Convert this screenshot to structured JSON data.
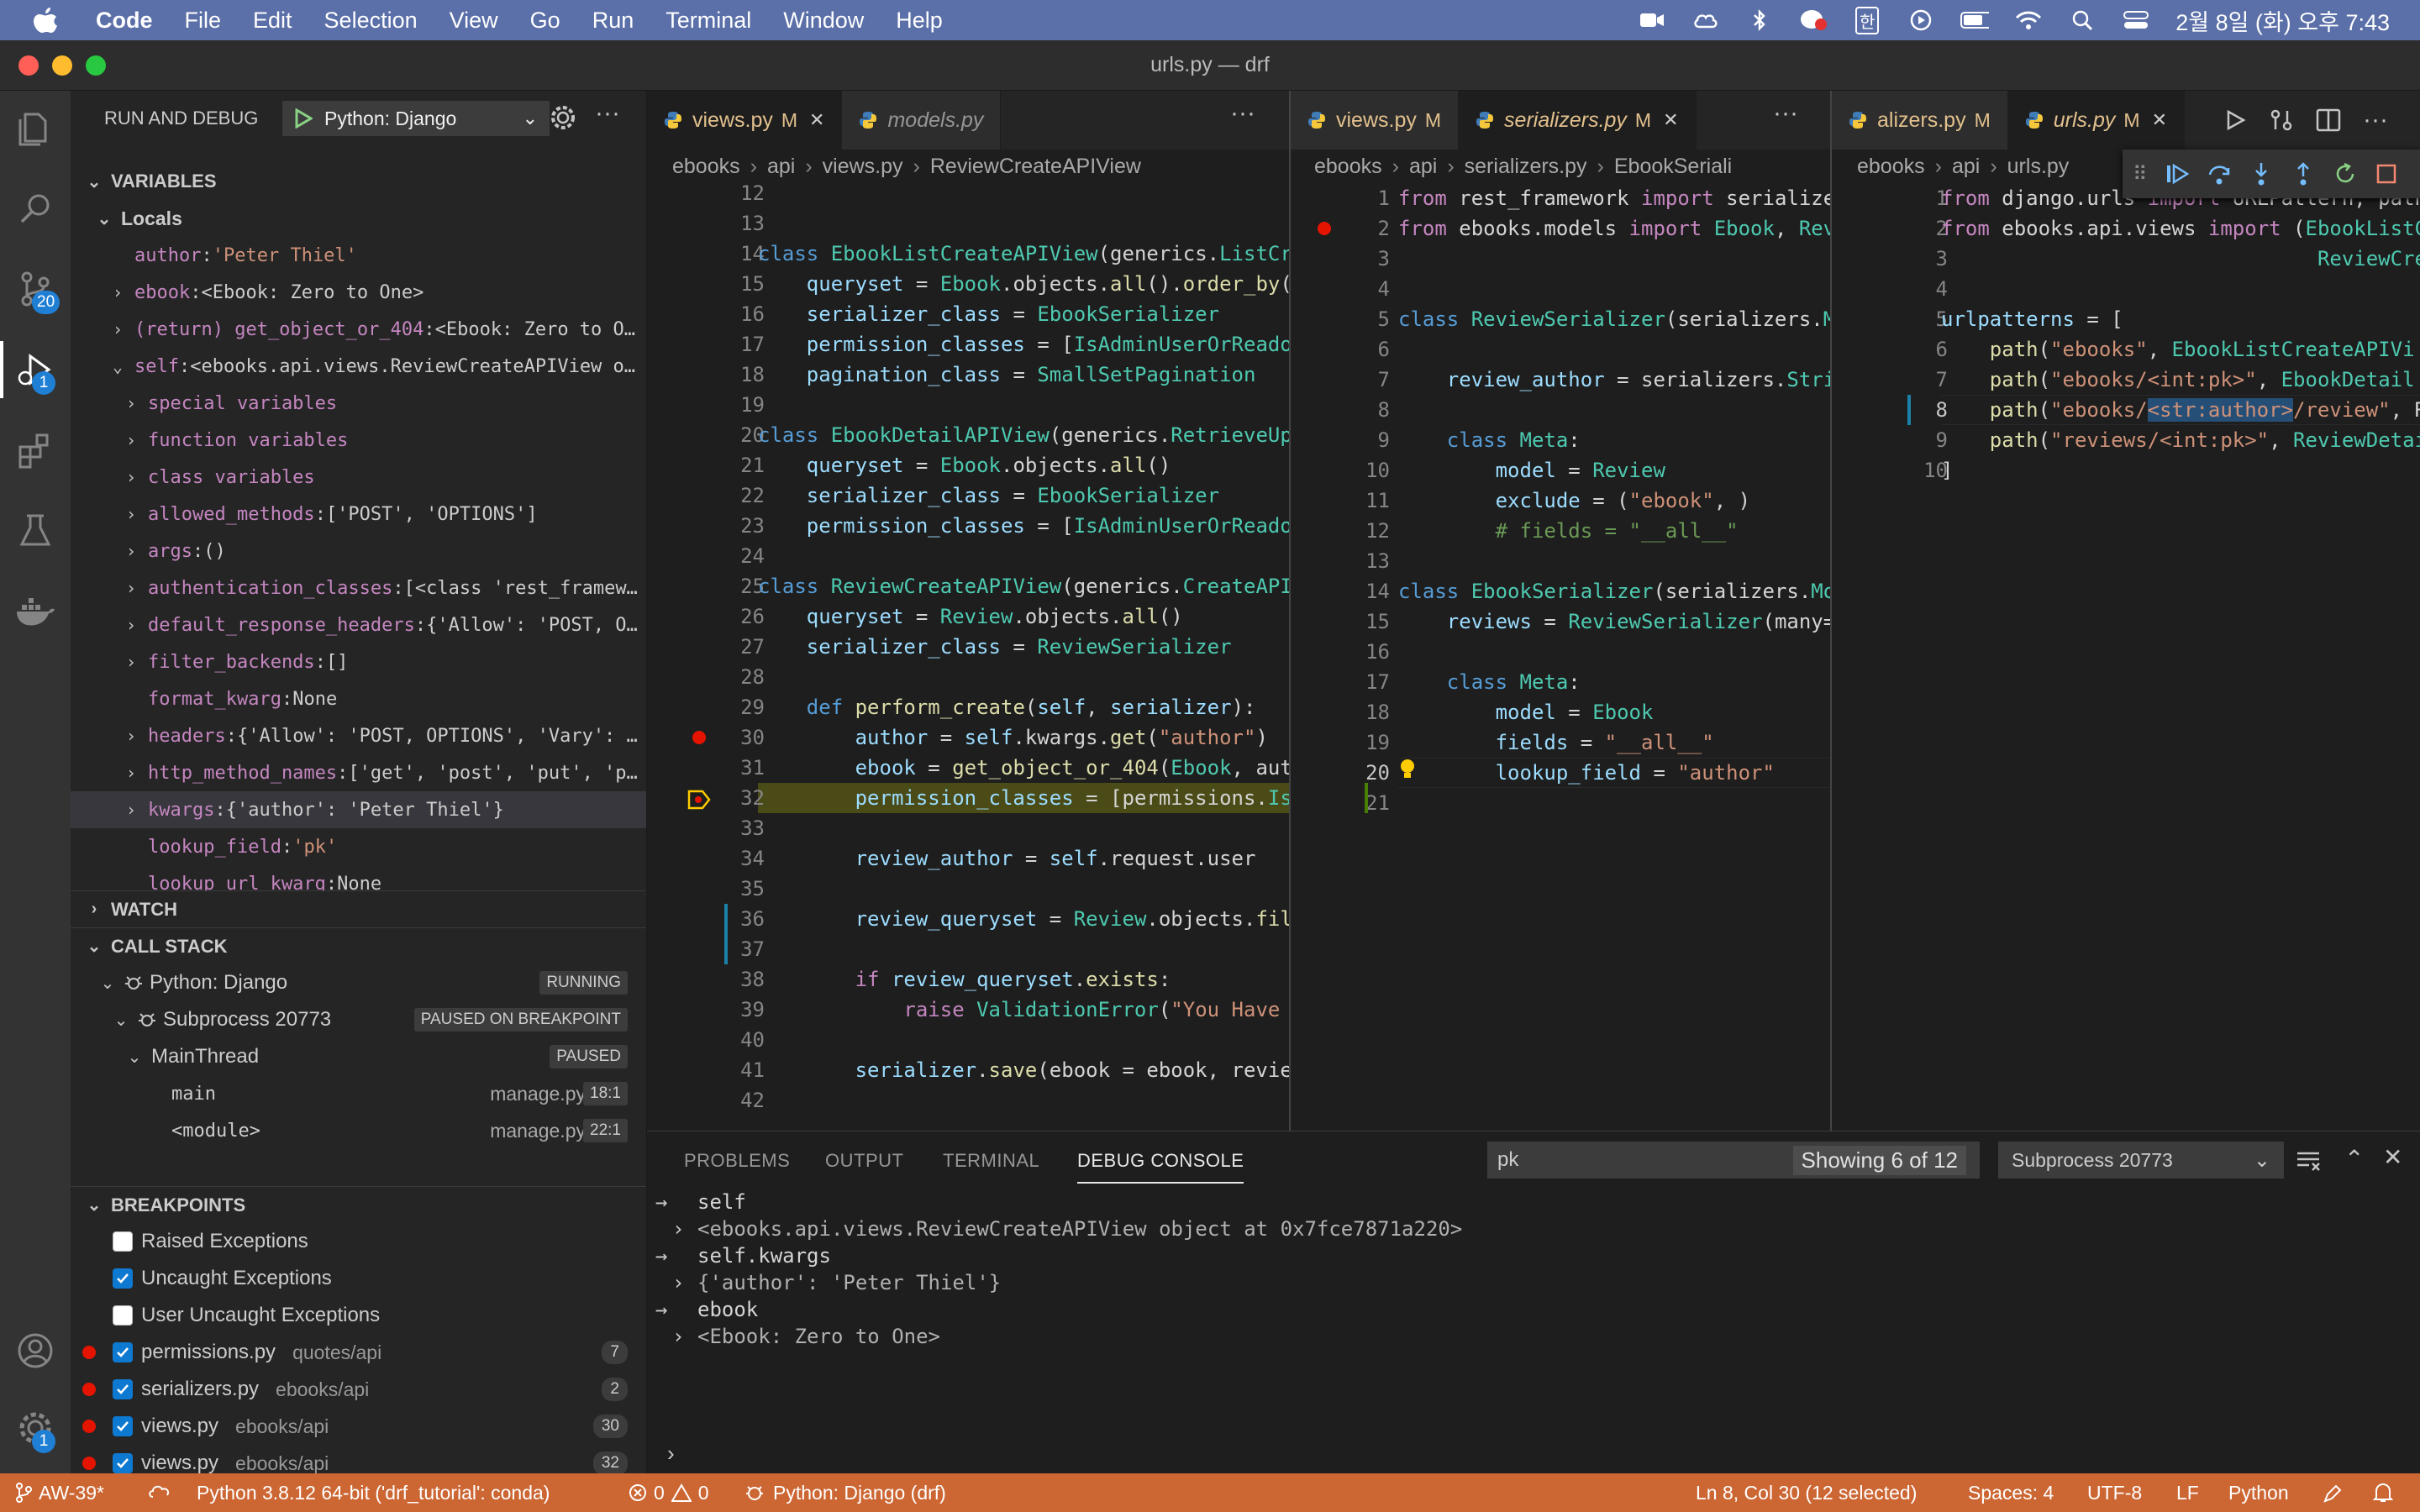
{
  "menubar": {
    "items": [
      "Code",
      "File",
      "Edit",
      "Selection",
      "View",
      "Go",
      "Run",
      "Terminal",
      "Window",
      "Help"
    ],
    "clock": "2월 8일 (화) 오후 7:43",
    "ime": "한"
  },
  "window": {
    "title": "urls.py — drf"
  },
  "activity": {
    "scm_badge": "20",
    "debug_badge": "1",
    "manage_badge": "1"
  },
  "sidebar": {
    "header": "RUN AND DEBUG",
    "config": "Python: Django",
    "variables_title": "VARIABLES",
    "locals_title": "Locals",
    "variables": [
      {
        "name": "author",
        "value": "'Peter Thiel'",
        "kind": "str",
        "expandable": false,
        "depth": 2
      },
      {
        "name": "ebook",
        "value": "<Ebook: Zero to One>",
        "kind": "obj",
        "expandable": true,
        "depth": 1
      },
      {
        "name": "(return) get_object_or_404",
        "value": "<Ebook: Zero to O…",
        "kind": "obj",
        "expandable": true,
        "depth": 1
      },
      {
        "name": "self",
        "value": "<ebooks.api.views.ReviewCreateAPIView o…",
        "kind": "obj",
        "expandable": true,
        "expanded": true,
        "depth": 1
      },
      {
        "name": "special variables",
        "value": "",
        "kind": "obj",
        "expandable": true,
        "depth": 3
      },
      {
        "name": "function variables",
        "value": "",
        "kind": "obj",
        "expandable": true,
        "depth": 3
      },
      {
        "name": "class variables",
        "value": "",
        "kind": "obj",
        "expandable": true,
        "depth": 3
      },
      {
        "name": "allowed_methods",
        "value": "['POST', 'OPTIONS']",
        "kind": "obj",
        "expandable": true,
        "depth": 3
      },
      {
        "name": "args",
        "value": "()",
        "kind": "obj",
        "expandable": true,
        "depth": 3
      },
      {
        "name": "authentication_classes",
        "value": "[<class 'rest_framew…",
        "kind": "obj",
        "expandable": true,
        "depth": 3
      },
      {
        "name": "default_response_headers",
        "value": "{'Allow': 'POST, O…",
        "kind": "obj",
        "expandable": true,
        "depth": 3
      },
      {
        "name": "filter_backends",
        "value": "[]",
        "kind": "obj",
        "expandable": true,
        "depth": 3
      },
      {
        "name": "format_kwarg",
        "value": "None",
        "kind": "obj",
        "expandable": false,
        "depth": 4
      },
      {
        "name": "headers",
        "value": "{'Allow': 'POST, OPTIONS', 'Vary': …",
        "kind": "obj",
        "expandable": true,
        "depth": 3
      },
      {
        "name": "http_method_names",
        "value": "['get', 'post', 'put', 'p…",
        "kind": "obj",
        "expandable": true,
        "depth": 3
      },
      {
        "name": "kwargs",
        "value": "{'author': 'Peter Thiel'}",
        "kind": "obj",
        "expandable": true,
        "depth": 3,
        "selected": true
      },
      {
        "name": "lookup_field",
        "value": "'pk'",
        "kind": "str",
        "expandable": false,
        "depth": 4
      },
      {
        "name": "lookup_url_kwarg",
        "value": "None",
        "kind": "obj",
        "expandable": false,
        "depth": 4
      }
    ],
    "watch_title": "WATCH",
    "callstack_title": "CALL STACK",
    "callstack": [
      {
        "label": "Python: Django",
        "pill": "RUNNING",
        "depth": 1,
        "icon": true
      },
      {
        "label": "Subprocess 20773",
        "pill": "PAUSED ON BREAKPOINT",
        "depth": 2,
        "icon": true
      },
      {
        "label": "MainThread",
        "pill": "PAUSED",
        "depth": 3,
        "icon": false
      }
    ],
    "frames": [
      {
        "name": "main",
        "file": "manage.py",
        "line": "18:1"
      },
      {
        "name": "<module>",
        "file": "manage.py",
        "line": "22:1"
      }
    ],
    "breakpoints_title": "BREAKPOINTS",
    "exception_bps": [
      {
        "label": "Raised Exceptions",
        "checked": false
      },
      {
        "label": "Uncaught Exceptions",
        "checked": true
      },
      {
        "label": "User Uncaught Exceptions",
        "checked": false
      }
    ],
    "file_bps": [
      {
        "file": "permissions.py",
        "path": "quotes/api",
        "count": "7"
      },
      {
        "file": "serializers.py",
        "path": "ebooks/api",
        "count": "2"
      },
      {
        "file": "views.py",
        "path": "ebooks/api",
        "count": "30"
      },
      {
        "file": "views.py",
        "path": "ebooks/api",
        "count": "32"
      }
    ]
  },
  "editor1": {
    "tabs": [
      {
        "name": "views.py",
        "mark": "M",
        "active": true,
        "close": "✕"
      },
      {
        "name": "models.py",
        "mark": "",
        "active": false,
        "italic": true
      }
    ],
    "breadcrumb": [
      "ebooks",
      "api",
      "views.py",
      "ReviewCreateAPIView"
    ],
    "lines": [
      {
        "n": "12",
        "html": ""
      },
      {
        "n": "13",
        "html": ""
      },
      {
        "n": "14",
        "html": "<span class='kw'>class</span> <span class='cls'>EbookListCreateAPIView</span><span class='pl'>(generics.</span><span class='cls'>ListCr</span>"
      },
      {
        "n": "15",
        "html": "    <span class='var'>queryset</span> <span class='pl'>=</span> <span class='cls'>Ebook</span><span class='pl'>.objects.</span><span class='fn'>all</span><span class='pl'>().</span><span class='fn'>order_by</span><span class='pl'>(</span>"
      },
      {
        "n": "16",
        "html": "    <span class='var'>serializer_class</span> <span class='pl'>=</span> <span class='cls'>EbookSerializer</span>"
      },
      {
        "n": "17",
        "html": "    <span class='var'>permission_classes</span> <span class='pl'>= [</span><span class='cls'>IsAdminUserOrReado</span>"
      },
      {
        "n": "18",
        "html": "    <span class='var'>pagination_class</span> <span class='pl'>=</span> <span class='cls'>SmallSetPagination</span>"
      },
      {
        "n": "19",
        "html": ""
      },
      {
        "n": "20",
        "html": "<span class='kw'>class</span> <span class='cls'>EbookDetailAPIView</span><span class='pl'>(generics.</span><span class='cls'>RetrieveUp</span>"
      },
      {
        "n": "21",
        "html": "    <span class='var'>queryset</span> <span class='pl'>=</span> <span class='cls'>Ebook</span><span class='pl'>.objects.</span><span class='fn'>all</span><span class='pl'>()</span>"
      },
      {
        "n": "22",
        "html": "    <span class='var'>serializer_class</span> <span class='pl'>=</span> <span class='cls'>EbookSerializer</span>"
      },
      {
        "n": "23",
        "html": "    <span class='var'>permission_classes</span> <span class='pl'>= [</span><span class='cls'>IsAdminUserOrReado</span>"
      },
      {
        "n": "24",
        "html": ""
      },
      {
        "n": "25",
        "html": "<span class='kw'>class</span> <span class='cls'>ReviewCreateAPIView</span><span class='pl'>(generics.</span><span class='cls'>CreateAPI</span>"
      },
      {
        "n": "26",
        "html": "    <span class='var'>queryset</span> <span class='pl'>=</span> <span class='cls'>Review</span><span class='pl'>.objects.</span><span class='fn'>all</span><span class='pl'>()</span>"
      },
      {
        "n": "27",
        "html": "    <span class='var'>serializer_class</span> <span class='pl'>=</span> <span class='cls'>ReviewSerializer</span>"
      },
      {
        "n": "28",
        "html": ""
      },
      {
        "n": "29",
        "html": "    <span class='kw'>def</span> <span class='fn'>perform_create</span><span class='pl'>(</span><span class='var'>self</span><span class='pl'>, </span><span class='var'>serializer</span><span class='pl'>):</span>"
      },
      {
        "n": "30",
        "html": "        <span class='var'>author</span> <span class='pl'>=</span> <span class='var'>self</span><span class='pl'>.kwargs.</span><span class='fn'>get</span><span class='pl'>(</span><span class='str'>\"author\"</span><span class='pl'>)</span>",
        "bp": true
      },
      {
        "n": "31",
        "html": "        <span class='var'>ebook</span> <span class='pl'>=</span> <span class='fn'>get_object_or_404</span><span class='pl'>(</span><span class='cls'>Ebook</span><span class='pl'>, aut</span>"
      },
      {
        "n": "32",
        "html": "        <span class='var'>permission_classes</span> <span class='pl'>= [permissions.</span><span class='cls'>Is</span>",
        "current": true
      },
      {
        "n": "33",
        "html": ""
      },
      {
        "n": "34",
        "html": "        <span class='var'>review_author</span> <span class='pl'>=</span> <span class='var'>self</span><span class='pl'>.request.user</span>"
      },
      {
        "n": "35",
        "html": ""
      },
      {
        "n": "36",
        "html": "        <span class='var'>review_queryset</span> <span class='pl'>=</span> <span class='cls'>Review</span><span class='pl'>.objects.</span><span class='fn'>fil</span>"
      },
      {
        "n": "37",
        "html": ""
      },
      {
        "n": "38",
        "html": "        <span class='kw2'>if</span> <span class='var'>review_queryset</span><span class='pl'>.</span><span class='fn'>exists</span><span class='pl'>:</span>"
      },
      {
        "n": "39",
        "html": "            <span class='kw2'>raise</span> <span class='cls'>ValidationError</span><span class='pl'>(</span><span class='str'>\"You Have </span>"
      },
      {
        "n": "40",
        "html": ""
      },
      {
        "n": "41",
        "html": "        <span class='var'>serializer</span><span class='pl'>.</span><span class='fn'>save</span><span class='pl'>(ebook = ebook, revie</span>"
      },
      {
        "n": "42",
        "html": ""
      }
    ]
  },
  "editor2": {
    "tabs": [
      {
        "name": "views.py",
        "mark": "M",
        "active": false
      },
      {
        "name": "serializers.py",
        "mark": "M",
        "active": true,
        "italic": true,
        "close": "✕"
      }
    ],
    "breadcrumb": [
      "ebooks",
      "api",
      "serializers.py",
      "EbookSeriali"
    ],
    "lines": [
      {
        "n": "1",
        "html": "<span class='kw2'>from</span> <span class='pl'>rest_framework</span> <span class='kw2'>import</span> <span class='pl'>serialize</span>"
      },
      {
        "n": "2",
        "html": "<span class='kw2'>from</span> <span class='pl'>ebooks.models</span> <span class='kw2'>import</span> <span class='cls'>Ebook</span><span class='pl'>, </span><span class='cls'>Rev</span>",
        "bp": true
      },
      {
        "n": "3",
        "html": ""
      },
      {
        "n": "4",
        "html": ""
      },
      {
        "n": "5",
        "html": "<span class='kw'>class</span> <span class='cls'>ReviewSerializer</span><span class='pl'>(serializers.</span><span class='cls'>M</span>"
      },
      {
        "n": "6",
        "html": ""
      },
      {
        "n": "7",
        "html": "    <span class='var'>review_author</span> <span class='pl'>= serializers.</span><span class='cls'>Stri</span>"
      },
      {
        "n": "8",
        "html": ""
      },
      {
        "n": "9",
        "html": "    <span class='kw'>class</span> <span class='cls'>Meta</span><span class='pl'>:</span>"
      },
      {
        "n": "10",
        "html": "        <span class='var'>model</span> <span class='pl'>=</span> <span class='cls'>Review</span>"
      },
      {
        "n": "11",
        "html": "        <span class='var'>exclude</span> <span class='pl'>= (</span><span class='str'>\"ebook\"</span><span class='pl'>, )</span>"
      },
      {
        "n": "12",
        "html": "        <span class='cmt'># fields = \"__all__\"</span>"
      },
      {
        "n": "13",
        "html": ""
      },
      {
        "n": "14",
        "html": "<span class='kw'>class</span> <span class='cls'>EbookSerializer</span><span class='pl'>(serializers.</span><span class='cls'>Mo</span>"
      },
      {
        "n": "15",
        "html": "    <span class='var'>reviews</span> <span class='pl'>=</span> <span class='cls'>ReviewSerializer</span><span class='pl'>(many=</span>"
      },
      {
        "n": "16",
        "html": ""
      },
      {
        "n": "17",
        "html": "    <span class='kw'>class</span> <span class='cls'>Meta</span><span class='pl'>:</span>"
      },
      {
        "n": "18",
        "html": "        <span class='var'>model</span> <span class='pl'>=</span> <span class='cls'>Ebook</span>"
      },
      {
        "n": "19",
        "html": "        <span class='var'>fields</span> <span class='pl'>=</span> <span class='str'>\"__all__\"</span>"
      },
      {
        "n": "20",
        "html": "        <span class='var'>lookup_field</span> <span class='pl'>=</span> <span class='str'>\"author\"</span>",
        "cursorline": true
      },
      {
        "n": "21",
        "html": ""
      }
    ]
  },
  "editor3": {
    "tabs": [
      {
        "name": "alizers.py",
        "mark": "M",
        "active": false
      },
      {
        "name": "urls.py",
        "mark": "M",
        "active": true,
        "italic": true,
        "close": "✕"
      }
    ],
    "breadcrumb": [
      "ebooks",
      "api",
      "urls.py"
    ],
    "lines": [
      {
        "n": "1",
        "html": "<span class='kw2'>from</span> <span class='pl'>django.urls</span> <span class='kw2'>import</span> <span class='pl'>URLPattern, path</span>"
      },
      {
        "n": "2",
        "html": "<span class='kw2'>from</span> <span class='pl'>ebooks.api.views</span> <span class='kw2'>import</span> <span class='pl'>(</span><span class='cls'>EbookListC</span>"
      },
      {
        "n": "3",
        "html": "                               <span class='cls'>ReviewCrea</span>"
      },
      {
        "n": "4",
        "html": ""
      },
      {
        "n": "5",
        "html": "<span class='var'>urlpatterns</span> <span class='pl'>= [</span>"
      },
      {
        "n": "6",
        "html": "    <span class='fn'>path</span><span class='pl'>(</span><span class='str'>\"ebooks\"</span><span class='pl'>, </span><span class='cls'>EbookListCreateAPIVi</span>"
      },
      {
        "n": "7",
        "html": "    <span class='fn'>path</span><span class='pl'>(</span><span class='str'>\"ebooks/&lt;int:pk&gt;\"</span><span class='pl'>, </span><span class='cls'>EbookDetail</span>"
      },
      {
        "n": "8",
        "html": "    <span class='fn'>path</span><span class='pl'>(</span><span class='str'>\"ebooks/<span style='background:#264f78'>&lt;str:author&gt;</span>/review\"</span><span class='pl'>, R</span>",
        "cursorline": true
      },
      {
        "n": "9",
        "html": "    <span class='fn'>path</span><span class='pl'>(</span><span class='str'>\"reviews/&lt;int:pk&gt;\"</span><span class='pl'>, </span><span class='cls'>ReviewDetai</span>"
      },
      {
        "n": "10",
        "html": "<span class='pl'>]</span>"
      }
    ]
  },
  "panel": {
    "tabs": [
      "PROBLEMS",
      "OUTPUT",
      "TERMINAL",
      "DEBUG CONSOLE"
    ],
    "filter": "pk",
    "filter_count": "Showing 6 of 12",
    "process": "Subprocess 20773",
    "console": [
      {
        "type": "in",
        "text": "self"
      },
      {
        "type": "out",
        "text": "<ebooks.api.views.ReviewCreateAPIView object at 0x7fce7871a220>"
      },
      {
        "type": "in",
        "text": "self.kwargs"
      },
      {
        "type": "out",
        "text": "{'author': 'Peter Thiel'}"
      },
      {
        "type": "in",
        "text": "ebook"
      },
      {
        "type": "out",
        "text": "<Ebook: Zero to One>"
      }
    ]
  },
  "statusbar": {
    "branch": "AW-39*",
    "interpreter": "Python 3.8.12 64-bit ('drf_tutorial': conda)",
    "errors": "0",
    "warnings": "0",
    "debug": "Python: Django (drf)",
    "position": "Ln 8, Col 30 (12 selected)",
    "spaces": "Spaces: 4",
    "encoding": "UTF-8",
    "eol": "LF",
    "language": "Python"
  }
}
